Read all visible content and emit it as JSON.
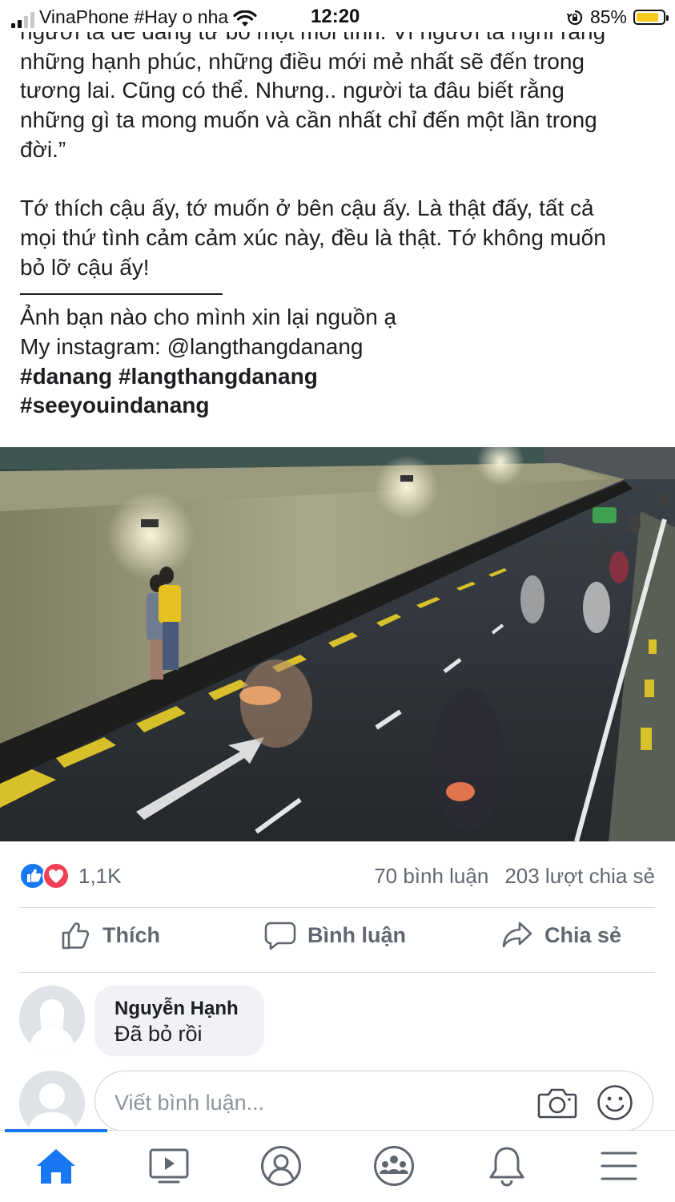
{
  "status_bar": {
    "carrier": "VinaPhone #Hay o nha",
    "time": "12:20",
    "battery": "85%",
    "battery_level": 0.85,
    "battery_color": "#f7c91c"
  },
  "post": {
    "partial_top_line": "người ta dễ dàng từ bỏ một mối tình. Vì người ta nghĩ rằng",
    "paragraph1_lines": [
      "những hạnh phúc, những điều mới mẻ nhất sẽ đến trong",
      "tương lai. Cũng có thể. Nhưng.. người ta đâu biết rằng",
      "những gì ta mong muốn và cần nhất chỉ đến một lần trong",
      "đời.”"
    ],
    "paragraph2_lines": [
      "Tớ thích cậu ấy, tớ muốn ở bên cậu ấy. Là thật đấy, tất cả",
      "mọi thứ tình cảm cảm xúc này, đều là thật. Tớ không muốn",
      "bỏ lỡ cậu ấy!"
    ],
    "source_line": "Ảnh bạn nào cho mình xin lại nguồn ạ",
    "instagram_line": "My instagram: @langthangdanang",
    "hashtags_line1": "#danang #langthangdanang",
    "hashtags_line2": "#seeyouindanang"
  },
  "reactions": {
    "icons": [
      "like-icon",
      "love-icon"
    ],
    "count": "1,1K",
    "comments": "70 bình luận",
    "shares": "203 lượt chia sẻ"
  },
  "actions": {
    "like": "Thích",
    "comment": "Bình luận",
    "share": "Chia sẻ"
  },
  "comments": [
    {
      "author": "Nguyễn Hạnh",
      "text": "Đã bỏ rồi"
    }
  ],
  "composer": {
    "placeholder": "Viết bình luận..."
  },
  "bottom_nav": {
    "items": [
      "home-icon",
      "watch-icon",
      "profile-icon",
      "groups-icon",
      "notifications-icon",
      "menu-icon"
    ],
    "active": "home-icon",
    "active_color": "#1877f2"
  },
  "colors": {
    "brand": "#1877f2",
    "love": "#f33e58",
    "text": "#1c1e21",
    "muted": "#606770"
  }
}
